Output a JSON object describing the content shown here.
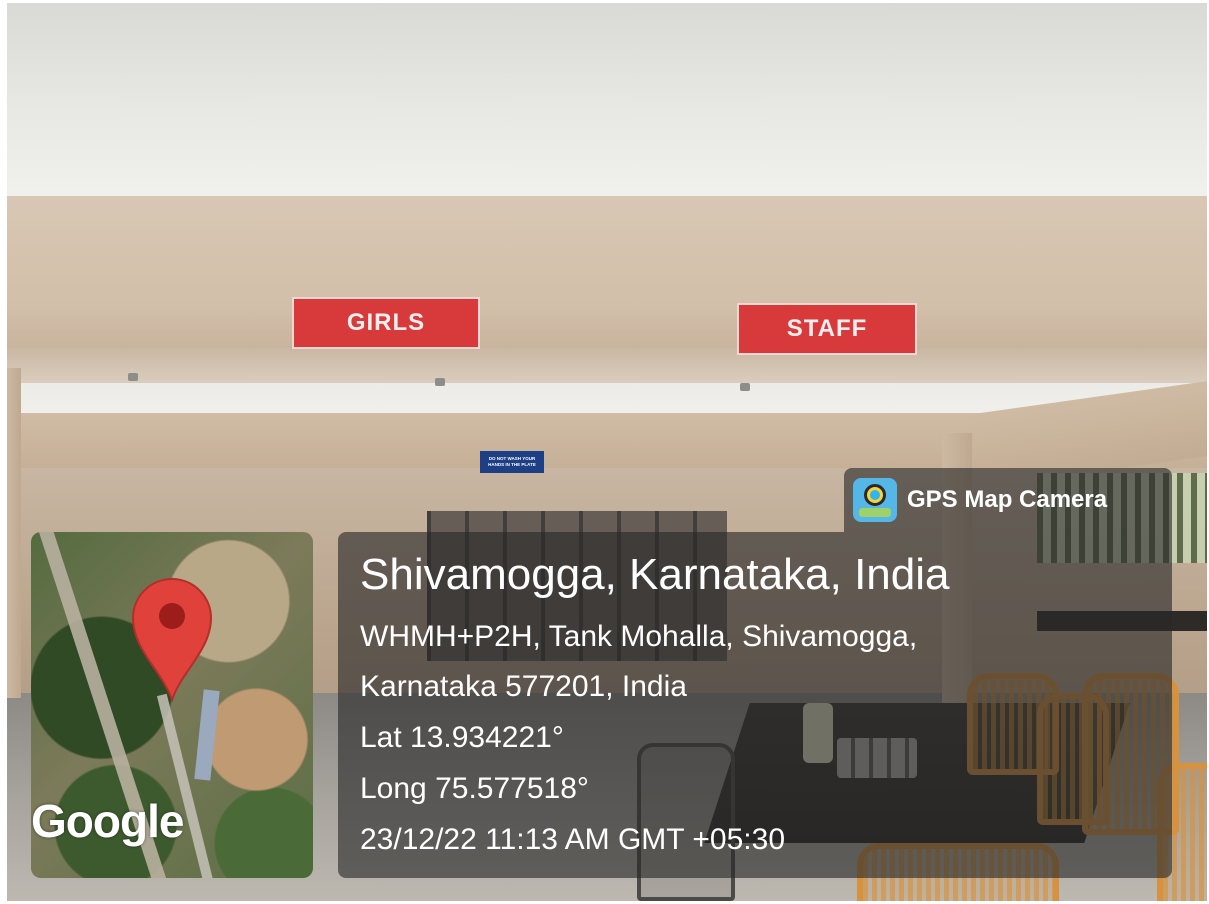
{
  "scene": {
    "sign_left": "GIRLS",
    "sign_right": "STAFF",
    "notice_line1": "DO NOT WASH YOUR",
    "notice_line2": "HANDS IN THE PLATE"
  },
  "badge": {
    "app_name": "GPS Map Camera",
    "icon": "gps-map-camera-icon"
  },
  "map": {
    "brand": "Google",
    "marker_icon": "map-pin-icon"
  },
  "location": {
    "title": "Shivamogga, Karnataka, India",
    "address_line1": "WHMH+P2H, Tank Mohalla, Shivamogga,",
    "address_line2": "Karnataka 577201, India",
    "latitude": "Lat 13.934221°",
    "longitude": "Long 75.577518°",
    "timestamp": "23/12/22 11:13 AM GMT +05:30"
  },
  "colors": {
    "sign_red": "#d83a3b",
    "overlay": "rgba(40,40,40,0.62)",
    "pin_red": "#e0413a"
  }
}
